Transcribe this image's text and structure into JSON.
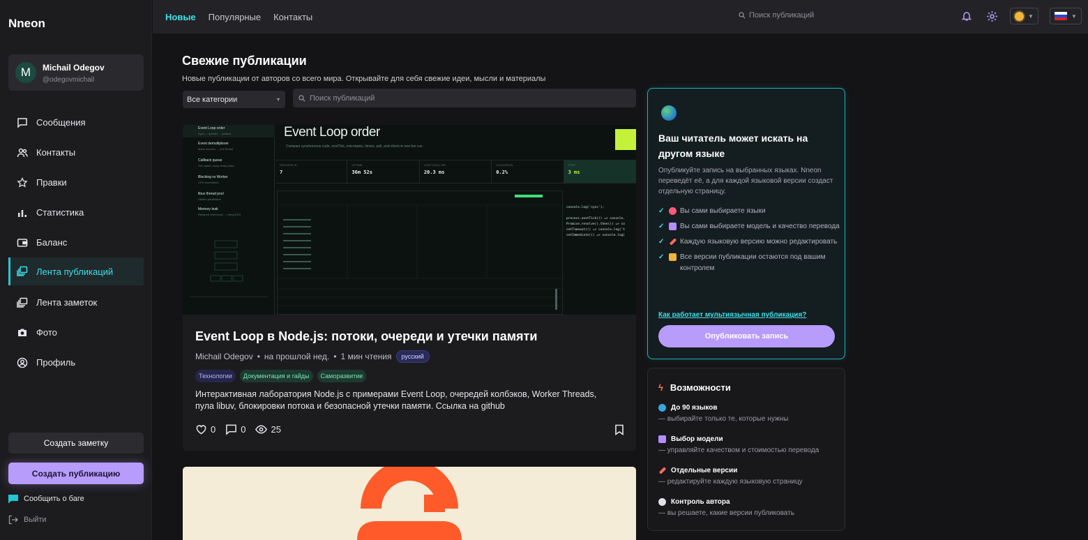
{
  "app": {
    "logo": "Nneon"
  },
  "user": {
    "initial": "M",
    "name": "Michail Odegov",
    "handle": "@odegovmichail"
  },
  "nav": [
    {
      "label": "Сообщения",
      "icon": "message-icon"
    },
    {
      "label": "Контакты",
      "icon": "contacts-icon"
    },
    {
      "label": "Правки",
      "icon": "star-icon"
    },
    {
      "label": "Статистика",
      "icon": "bar-chart-icon"
    },
    {
      "label": "Баланс",
      "icon": "wallet-icon"
    },
    {
      "label": "Лента публикаций",
      "icon": "feed-icon",
      "active": true
    },
    {
      "label": "Лента заметок",
      "icon": "notes-feed-icon"
    },
    {
      "label": "Фото",
      "icon": "camera-icon"
    },
    {
      "label": "Профиль",
      "icon": "profile-icon"
    }
  ],
  "sidebar_buttons": {
    "create_note": "Создать заметку",
    "create_post": "Создать публикацию",
    "report_bug": "Сообщить о баге",
    "logout": "Выйти"
  },
  "topbar": {
    "tabs": [
      "Новые",
      "Популярные",
      "Контакты"
    ],
    "search_placeholder": "Поиск публикаций"
  },
  "main": {
    "title": "Свежие публикации",
    "subtitle": "Новые публикации от авторов со всего мира. Открывайте для себя свежие идеи, мысли и материалы",
    "category_select": "Все категории",
    "search_placeholder": "Поиск публикаций"
  },
  "post": {
    "image": {
      "title": "Event Loop order",
      "subtitle": "Compare synchronous code, nextTick, microtasks, timers, poll, and check in one live run.",
      "sidebar_items": [
        {
          "title": "Event Loop order",
          "sub": "Sync → queues → phases"
        },
        {
          "title": "Event demultiplexer",
          "sub": "Many sources → one thread"
        },
        {
          "title": "Callback queue",
          "sub": "One stack, many ready tasks"
        },
        {
          "title": "Blocking vs Worker",
          "sub": "CPU boundaries"
        },
        {
          "title": "libuv thread pool",
          "sub": "Hidden parallelism"
        },
        {
          "title": "Memory leak",
          "sub": "Retained references → rising RSS"
        }
      ],
      "stats": [
        {
          "label": "PROCESS ID",
          "value": "7"
        },
        {
          "label": "UPTIME",
          "value": "36m 52s"
        },
        {
          "label": "LOOP STALL MS",
          "value": "20.3 ms"
        },
        {
          "label": "UTILIZATION",
          "value": "0.2%"
        },
        {
          "label": "STEP",
          "value": "3 ms"
        }
      ],
      "code": [
        "console.log('sync');",
        "",
        "process.nextTick(() => console.",
        "Promise.resolve().then(() => co",
        "setTimeout(() => console.log('t",
        "setImmediate(() => console.log("
      ]
    },
    "title": "Event Loop в Node.js: потоки, очереди и утечки памяти",
    "author": "Michail Odegov",
    "time": "на прошлой нед.",
    "read_time": "1 мин чтения",
    "language": "русский",
    "tags": [
      "Технологии",
      "Документация и гайды",
      "Саморазвитие"
    ],
    "excerpt": "Интерактивная лаборатория Node.js с примерами Event Loop, очередей колбэков, Worker Threads, пула libuv, блокировки потока и безопасной утечки памяти. Ссылка на github",
    "likes": "0",
    "comments": "0",
    "views": "25"
  },
  "promo": {
    "title": "Ваш читатель может искать на другом языке",
    "description": "Опубликуйте запись на выбранных языках. Nneon переведёт её, а для каждой языковой версии создаст отдельную страницу.",
    "checks": [
      {
        "text": "Вы сами выбираете языки",
        "color": "#ff5a7a"
      },
      {
        "text": "Вы сами выбираете модель и качество перевода",
        "color": "#b48cff"
      },
      {
        "text": "Каждую языковую версию можно редактировать",
        "color": "#ff6b5a"
      },
      {
        "text": "Все версии публикации остаются под вашим контролем",
        "color": "#f2b33d"
      }
    ],
    "link": "Как работает мультиязычная публикация?",
    "button": "Опубликовать запись"
  },
  "features": {
    "title": "Возможности",
    "items": [
      {
        "title": "До 90 языков",
        "desc": "— выбирайте только те, которые нужны",
        "color": "#3aa6e0"
      },
      {
        "title": "Выбор модели",
        "desc": "— управляйте качеством и стоимостью перевода",
        "color": "#b48cff"
      },
      {
        "title": "Отдельные версии",
        "desc": "— редактируйте каждую языковую страницу",
        "color": "#ff6b5a"
      },
      {
        "title": "Контроль автора",
        "desc": "— вы решаете, какие версии публиковать",
        "color": "#e0e0e6"
      }
    ]
  },
  "colors": {
    "accent": "#3ee0ea",
    "primary_button": "#b79cfb",
    "background": "#141416"
  }
}
